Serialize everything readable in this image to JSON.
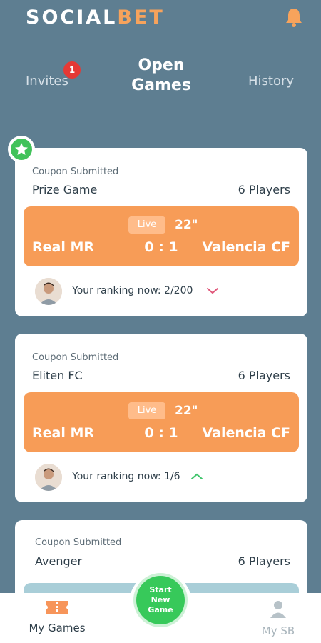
{
  "app": {
    "logo_part1": "SOCIAL",
    "logo_part2": "BET"
  },
  "tabs": {
    "invites": "Invites",
    "invites_badge": "1",
    "open_games_line1": "Open",
    "open_games_line2": "Games",
    "history": "History"
  },
  "cards": [
    {
      "status": "Coupon Submitted",
      "name": "Prize Game",
      "players": "6 Players",
      "live": "Live",
      "minute": "22\"",
      "home": "Real MR",
      "score": "0 : 1",
      "away": "Valencia CF",
      "ranking": "Your ranking now: 2/200",
      "trend": "down"
    },
    {
      "status": "Coupon Submitted",
      "name": "Eliten FC",
      "players": "6 Players",
      "live": "Live",
      "minute": "22\"",
      "home": "Real MR",
      "score": "0 : 1",
      "away": "Valencia CF",
      "ranking": "Your ranking now: 1/6",
      "trend": "up"
    },
    {
      "status": "Coupon Submitted",
      "name": "Avenger",
      "players": "6 Players"
    }
  ],
  "fab": {
    "line1": "Start",
    "line2": "New",
    "line3": "Game"
  },
  "nav": {
    "my_games": "My Games",
    "my_sb": "My SB"
  },
  "colors": {
    "background": "#5e7e91",
    "accent": "#f79c57",
    "green": "#37c95a",
    "badge": "#e53935"
  },
  "icons": [
    "bell-icon",
    "star-icon",
    "chevron-down-icon",
    "chevron-up-icon",
    "ticket-icon",
    "user-icon"
  ]
}
